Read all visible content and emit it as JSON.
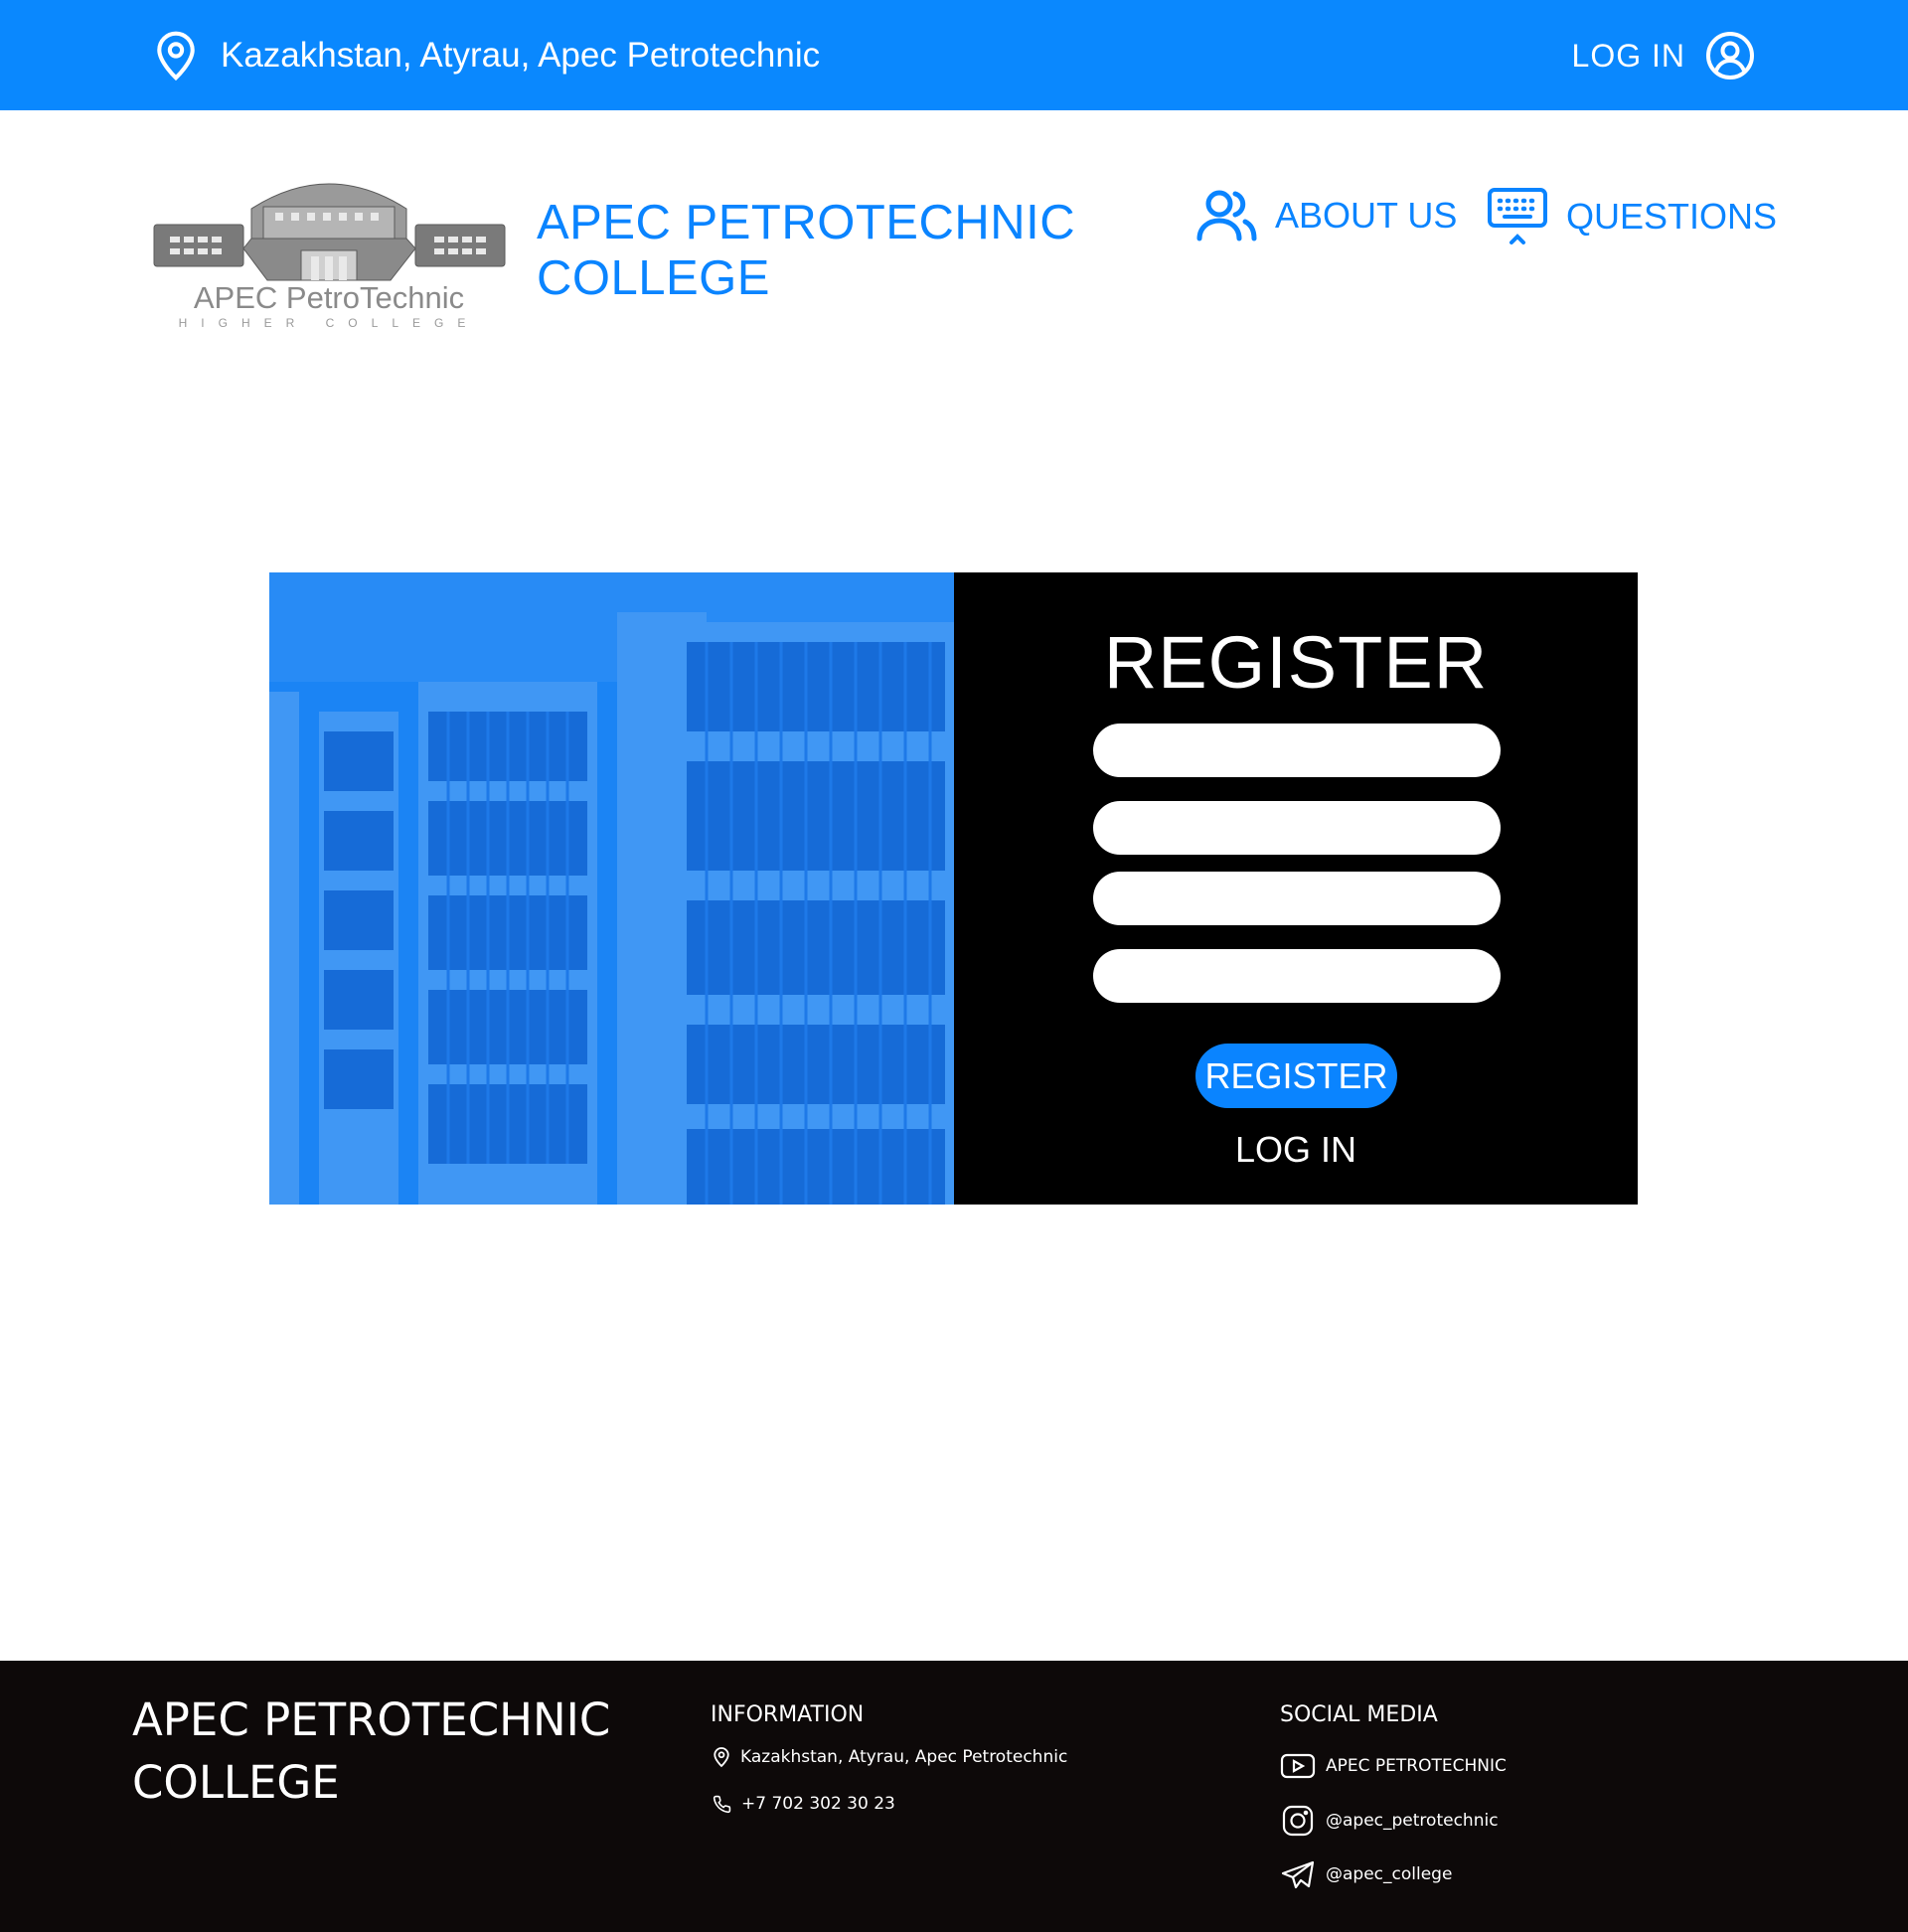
{
  "topbar": {
    "location": "Kazakhstan, Atyrau, Apec Petrotechnic",
    "login_label": "LOG IN",
    "icons": {
      "location": "map-pin-icon",
      "account": "user-circle-icon"
    }
  },
  "header": {
    "logo": {
      "name": "APEC PetroTechnic",
      "subtitle": "HIGHER COLLEGE"
    },
    "brand_line1": "APEC PETROTECHNIC",
    "brand_line2": "COLLEGE",
    "nav": [
      {
        "label": "ABOUT US",
        "icon": "users-icon"
      },
      {
        "label": "QUESTIONS",
        "icon": "keyboard-icon"
      }
    ]
  },
  "register": {
    "title": "REGISTER",
    "fields": [
      {
        "value": "",
        "placeholder": ""
      },
      {
        "value": "",
        "placeholder": ""
      },
      {
        "value": "",
        "placeholder": ""
      },
      {
        "value": "",
        "placeholder": ""
      }
    ],
    "submit_label": "REGISTER",
    "login_link": "LOG IN"
  },
  "footer": {
    "brand_line1": "APEC PETROTECHNIC",
    "brand_line2": "COLLEGE",
    "info": {
      "title": "INFORMATION",
      "address": "Kazakhstan, Atyrau, Apec Petrotechnic",
      "phone": "+7 702 302 30 23"
    },
    "social": {
      "title": "SOCIAL MEDIA",
      "youtube": "APEC PETROTECHNIC",
      "instagram": "@apec_petrotechnic",
      "telegram": "@apec_college"
    }
  },
  "colors": {
    "brand_blue": "#0a88fe",
    "panel_black": "#000000",
    "footer_bg": "#0d0909"
  }
}
